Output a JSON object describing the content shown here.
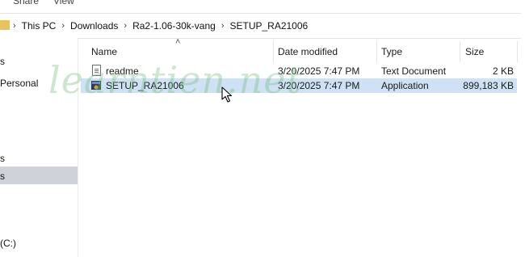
{
  "ribbon": {
    "tabs": [
      "Share",
      "View"
    ]
  },
  "address_bar": {
    "crumbs": [
      "This PC",
      "Downloads",
      "Ra2-1.06-30k-vang",
      "SETUP_RA21006"
    ]
  },
  "sidebar": {
    "items": [
      "s",
      "Personal",
      "s",
      "s",
      "(C:)"
    ]
  },
  "columns": {
    "name": "Name",
    "date": "Date modified",
    "type": "Type",
    "size": "Size"
  },
  "files": [
    {
      "name": "readme",
      "date": "3/20/2025 7:47 PM",
      "type": "Text Document",
      "size": "2 KB",
      "icon": "text-file-icon"
    },
    {
      "name": "SETUP_RA21006",
      "date": "3/20/2025 7:47 PM",
      "type": "Application",
      "size": "899,183 KB",
      "icon": "application-icon"
    }
  ],
  "watermark": "learntien.net",
  "colors": {
    "selection": "#cfe2f5",
    "sidebar_selected": "#cfd3d9",
    "watermark": "#78be82"
  }
}
